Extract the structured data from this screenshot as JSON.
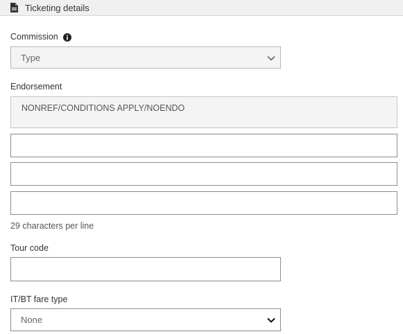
{
  "header": {
    "title": "Ticketing details",
    "icon": "document-icon"
  },
  "commission": {
    "label": "Commission",
    "info_icon": "info-icon",
    "select_value": "Type"
  },
  "endorsement": {
    "label": "Endorsement",
    "prefilled_value": "NONREF/CONDITIONS APPLY/NOENDO",
    "lines": [
      "",
      "",
      ""
    ],
    "helper_text": "29 characters per line"
  },
  "tour_code": {
    "label": "Tour code",
    "value": ""
  },
  "itbt_fare_type": {
    "label": "IT/BT fare type",
    "select_value": "None"
  }
}
